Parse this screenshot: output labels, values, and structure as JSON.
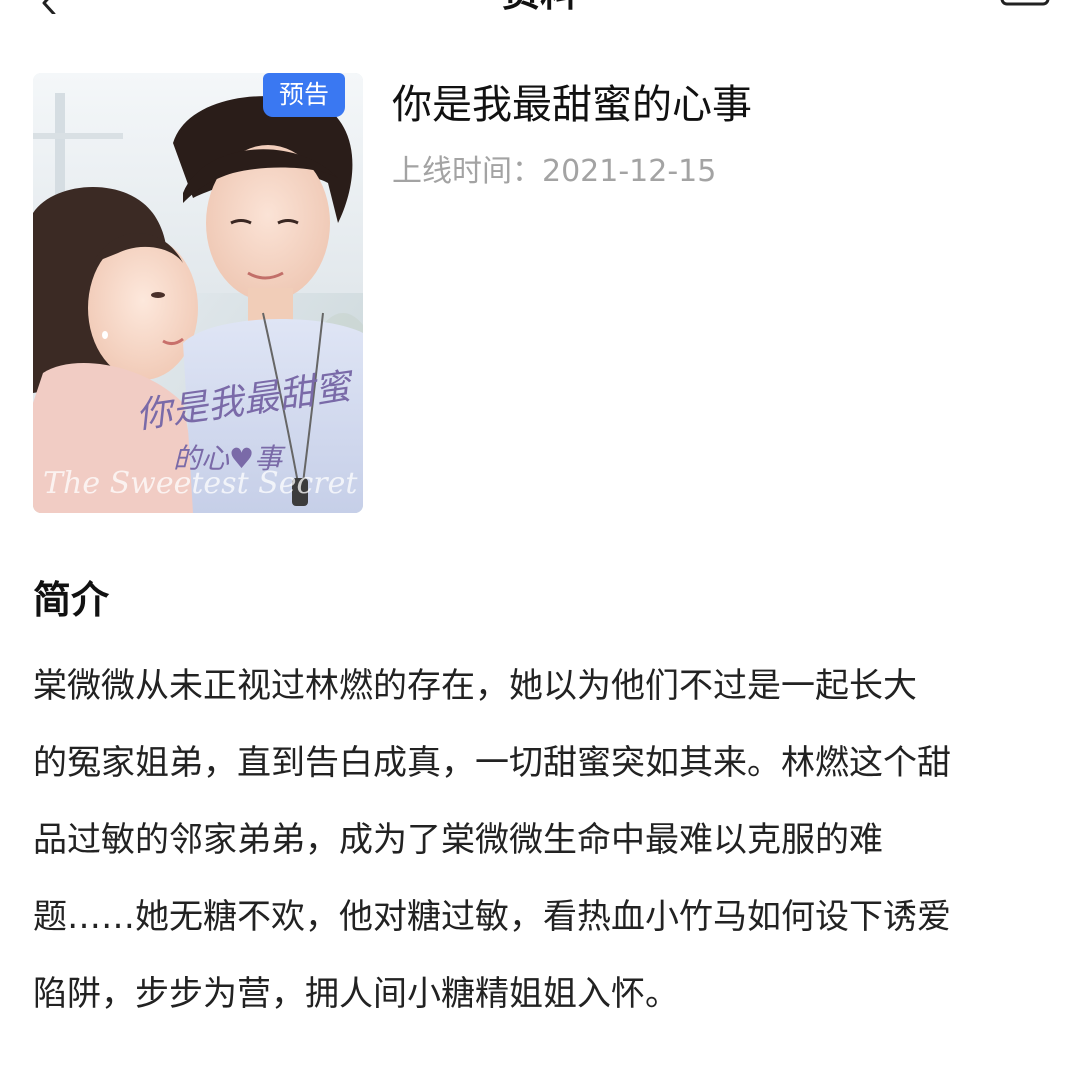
{
  "header": {
    "title": "资料",
    "back_icon": "chevron-left-icon",
    "menu_icon": "more-icon"
  },
  "poster": {
    "badge": "预告",
    "badge_color": "#3a78f2",
    "handwritten_title": "你是我最甜蜜的心事",
    "english_title": "The Sweetest Secret"
  },
  "drama": {
    "title": "你是我最甜蜜的心事",
    "release_label": "上线时间：2021-12-15"
  },
  "synopsis": {
    "heading": "简介",
    "lines": [
      "棠微微从未正视过林燃的存在，她以为他们不过是一起长大",
      "的冤家姐弟，直到告白成真，一切甜蜜突如其来。林燃这个甜",
      "品过敏的邻家弟弟，成为了棠微微生命中最难以克服的难",
      "题……她无糖不欢，他对糖过敏，看热血小竹马如何设下诱爱",
      "陷阱，步步为营，拥人间小糖精姐姐入怀。"
    ]
  }
}
